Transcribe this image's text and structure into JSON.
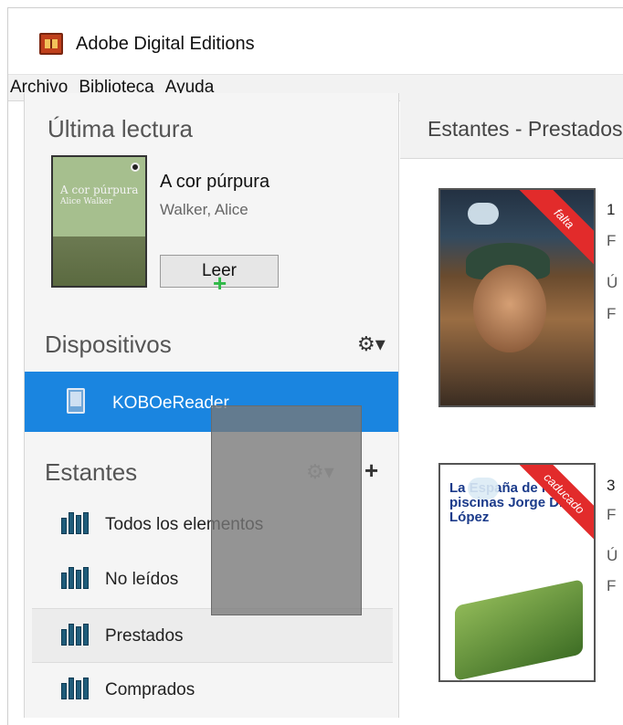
{
  "window": {
    "title": "Adobe Digital Editions"
  },
  "menu": [
    "Archivo",
    "Biblioteca",
    "Ayuda"
  ],
  "sidebar": {
    "last_read": {
      "heading": "Última lectura",
      "book": {
        "cover_title": "A cor púrpura",
        "cover_author": "Alice Walker",
        "title": "A cor púrpura",
        "author": "Walker, Alice"
      },
      "read_button": "Leer"
    },
    "devices": {
      "heading": "Dispositivos",
      "items": [
        {
          "label": "KOBOeReader",
          "selected": true
        }
      ]
    },
    "shelves": {
      "heading": "Estantes",
      "items": [
        {
          "label": "Todos los elementos"
        },
        {
          "label": "No leídos"
        },
        {
          "label": "Prestados",
          "selected": true
        },
        {
          "label": "Comprados"
        }
      ]
    }
  },
  "content": {
    "header": "Estantes - Prestados",
    "books": [
      {
        "status": "falta",
        "cover_text": "",
        "partial_text": [
          "1",
          "F",
          "Ú",
          "F"
        ]
      },
      {
        "status": "caducado",
        "cover_text": "La España de las piscinas Jorge Dioni López",
        "partial_text": [
          "3",
          "F",
          "Ú",
          "F"
        ]
      }
    ]
  },
  "colors": {
    "accent": "#1a85e0",
    "ribbon": "#e22b2b",
    "drag_plus": "#2fb847"
  }
}
